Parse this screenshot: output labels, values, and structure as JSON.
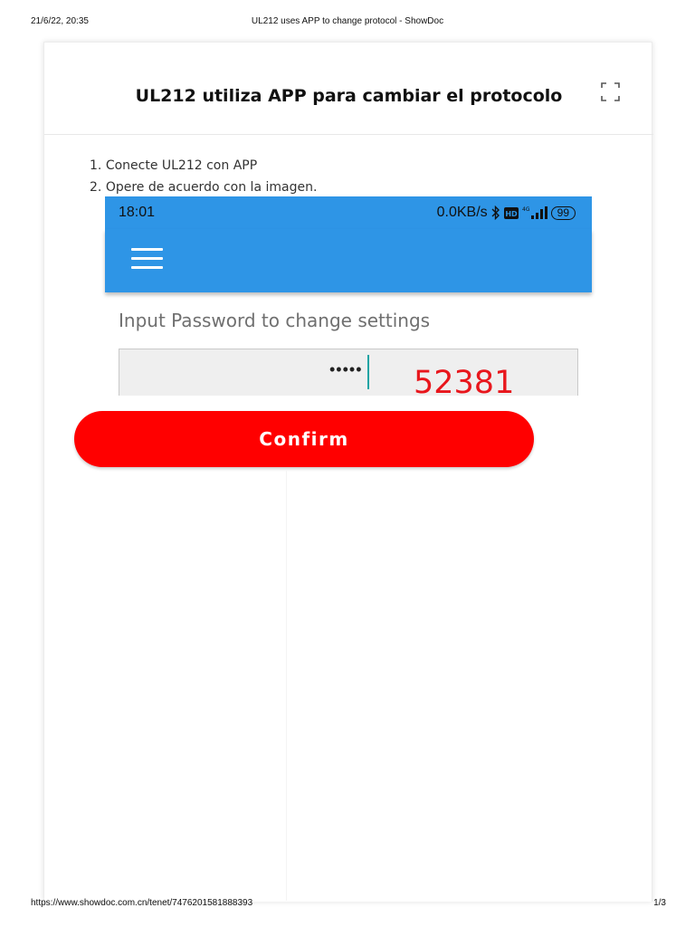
{
  "print_header": {
    "datetime": "21/6/22, 20:35",
    "title": "UL212 uses APP to change protocol - ShowDoc"
  },
  "doc": {
    "title": "UL212 utiliza APP para cambiar el protocolo",
    "steps": [
      "Conecte UL212 con APP",
      "Opere de acuerdo con la imagen."
    ]
  },
  "phone": {
    "time": "18:01",
    "network_speed": "0.0KB/s",
    "battery": "99",
    "password_label": "Input Password to change settings",
    "password_masked": "•••••",
    "password_annotation": "52381",
    "confirm_label": "Confirm",
    "colors": {
      "app_bar": "#2e95e6",
      "confirm": "#ff0000",
      "annotation": "#e8161c"
    }
  },
  "print_footer": {
    "url": "https://www.showdoc.com.cn/tenet/7476201581888393",
    "page": "1/3"
  }
}
